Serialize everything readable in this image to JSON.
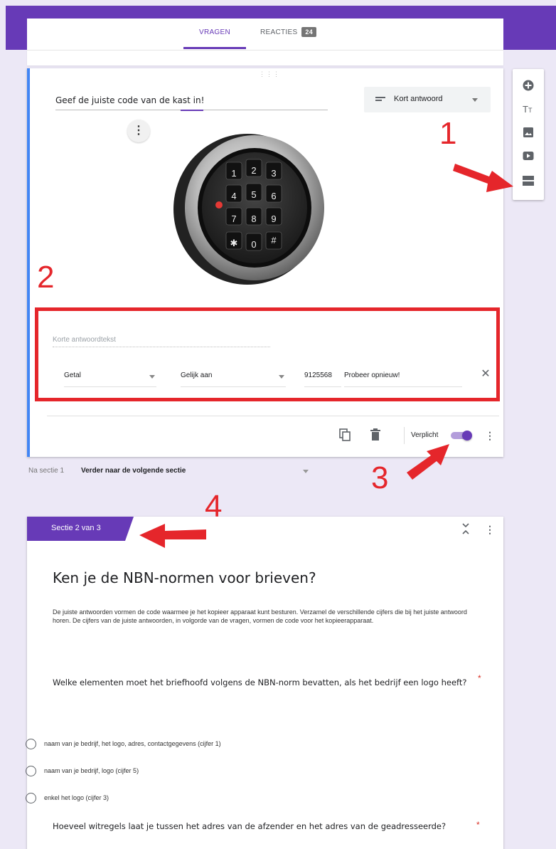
{
  "tabs": {
    "questions": "VRAGEN",
    "responses": "REACTIES",
    "response_count": "24"
  },
  "question": {
    "title": "Geef de juiste code van de kast in!",
    "type_label": "Kort antwoord",
    "image_icon": "electronic-safe-keypad-lock-image"
  },
  "validation": {
    "answer_placeholder": "Korte antwoordtekst",
    "type": "Getal",
    "condition": "Gelijk aan",
    "value": "9125568",
    "error_text": "Probeer opnieuw!"
  },
  "footer": {
    "required_label": "Verplicht",
    "required_on": true
  },
  "after_section": {
    "label": "Na sectie 1",
    "value": "Verder naar de volgende sectie"
  },
  "section": {
    "tab_label": "Sectie 2 van 3",
    "title": "Ken je de NBN-normen voor brieven?",
    "description": "De juiste antwoorden vormen de code waarmee je het kopieer apparaat kunt besturen. Verzamel de verschillende cijfers die bij het juiste antwoord horen. De cijfers van de juiste antwoorden, in volgorde van de vragen, vormen de code voor het kopieerapparaat."
  },
  "questions": [
    {
      "title": "Welke elementen moet het briefhoofd volgens de NBN-norm bevatten, als het bedrijf een logo heeft?",
      "required_mark": "*",
      "options": [
        "naam van je bedrijf, het logo, adres, contactgegevens (cijfer 1)",
        "naam van je bedrijf, logo (cijfer 5)",
        "enkel het logo (cijfer 3)"
      ]
    },
    {
      "title": "Hoeveel witregels laat je tussen het adres van de afzender en het adres van de geadresseerde?",
      "required_mark": "*"
    }
  ],
  "annotations": {
    "one": "1",
    "two": "2",
    "three": "3",
    "four": "4"
  },
  "colors": {
    "accent": "#673ab7",
    "annotation_red": "#e5262b",
    "focus_blue": "#4285f4",
    "background": "#ece8f6"
  },
  "icons": {
    "toolbar": [
      "add-question-icon",
      "add-title-icon",
      "add-image-icon",
      "add-video-icon",
      "add-section-icon"
    ],
    "footer": [
      "duplicate-icon",
      "delete-icon",
      "more-vert-icon"
    ]
  }
}
